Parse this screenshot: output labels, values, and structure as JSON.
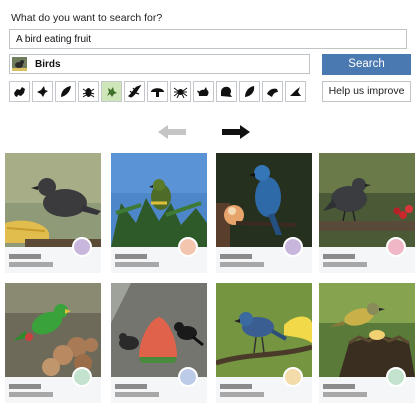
{
  "search": {
    "prompt": "What do you want to search for?",
    "query": "A bird eating fruit",
    "taxon": "Birds",
    "button": "Search",
    "help": "Help us improve"
  },
  "taxon_icons": [
    {
      "name": "all-taxa-icon"
    },
    {
      "name": "birds-icon"
    },
    {
      "name": "plants-icon"
    },
    {
      "name": "insects-icon"
    },
    {
      "name": "amphibians-icon",
      "active": true
    },
    {
      "name": "reptiles-icon"
    },
    {
      "name": "fungi-icon"
    },
    {
      "name": "arachnids-icon"
    },
    {
      "name": "mammals-icon"
    },
    {
      "name": "mollusks-icon"
    },
    {
      "name": "ray-finned-fishes-icon"
    },
    {
      "name": "protozoa-icon"
    },
    {
      "name": "chromista-icon"
    }
  ],
  "colors": {
    "search_button": "#4a78b0",
    "active_icon": "#cfe6b8",
    "card_dots": [
      "#c9b6dc",
      "#f3c5ae",
      "#c9b6dc",
      "#f0b8c6",
      "#c3e3cf",
      "#bccbe8",
      "#f3dcaa",
      "#c3e3cf"
    ]
  },
  "results": [
    {
      "id": "result-1",
      "subject": "dark bird eating banana"
    },
    {
      "id": "result-2",
      "subject": "green bird in palm"
    },
    {
      "id": "result-3",
      "subject": "blue bird with apple"
    },
    {
      "id": "result-4",
      "subject": "dark bird near cherries"
    },
    {
      "id": "result-5",
      "subject": "green bird on fruit pile"
    },
    {
      "id": "result-6",
      "subject": "birds at watermelon"
    },
    {
      "id": "result-7",
      "subject": "blue bird with banana"
    },
    {
      "id": "result-8",
      "subject": "yellow bird on fruit"
    }
  ]
}
